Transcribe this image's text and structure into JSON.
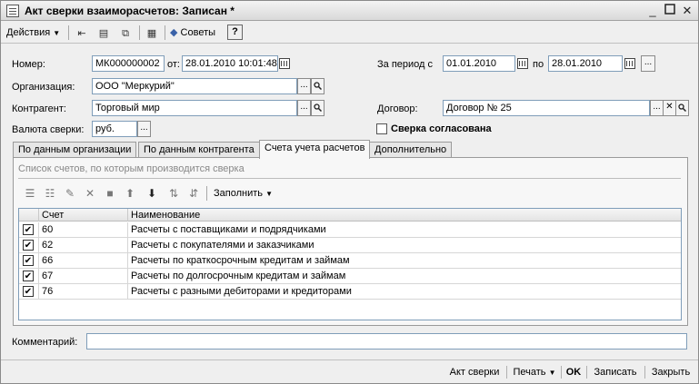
{
  "window": {
    "title": "Акт сверки взаиморасчетов: Записан *",
    "minimize_icon": "minimize-icon",
    "maximize_icon": "maximize-icon",
    "close_icon": "close-icon"
  },
  "toolbar": {
    "actions_label": "Действия",
    "advice_label": "Советы",
    "help_label": "?"
  },
  "header": {
    "number_label": "Номер:",
    "number_value": "МК000000002",
    "date_from_label": "от:",
    "date_value": "28.01.2010 10:01:48",
    "period_label": "За период с",
    "period_start": "01.01.2010",
    "period_to_label": "по",
    "period_end": "28.01.2010",
    "organization_label": "Организация:",
    "organization_value": "ООО \"Меркурий\"",
    "counterparty_label": "Контрагент:",
    "counterparty_value": "Торговый мир",
    "contract_label": "Договор:",
    "contract_value": "Договор № 25",
    "currency_label": "Валюта сверки:",
    "currency_value": "руб.",
    "agreed_label": "Сверка согласована",
    "agreed_checked": false
  },
  "tabs": [
    {
      "label": "По данным организации",
      "active": false
    },
    {
      "label": "По данным контрагента",
      "active": false
    },
    {
      "label": "Счета учета расчетов",
      "active": true
    },
    {
      "label": "Дополнительно",
      "active": false
    }
  ],
  "accounts_panel": {
    "caption": "Список счетов, по которым производится сверка",
    "fill_label": "Заполнить",
    "columns": {
      "account": "Счет",
      "name": "Наименование"
    },
    "rows": [
      {
        "checked": true,
        "account": "60",
        "name": "Расчеты с поставщиками и подрядчиками"
      },
      {
        "checked": true,
        "account": "62",
        "name": "Расчеты с покупателями и заказчиками"
      },
      {
        "checked": true,
        "account": "66",
        "name": "Расчеты по краткосрочным кредитам и займам"
      },
      {
        "checked": true,
        "account": "67",
        "name": "Расчеты по долгосрочным кредитам и займам"
      },
      {
        "checked": true,
        "account": "76",
        "name": "Расчеты с разными дебиторами и кредиторами"
      }
    ]
  },
  "comment": {
    "label": "Комментарий:",
    "value": ""
  },
  "footer": {
    "act_label": "Акт сверки",
    "print_label": "Печать",
    "ok_label": "OK",
    "save_label": "Записать",
    "close_label": "Закрыть"
  }
}
